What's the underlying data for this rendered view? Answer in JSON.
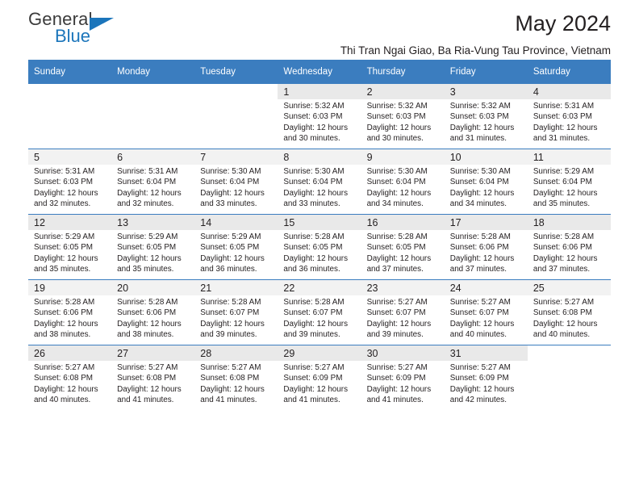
{
  "brand": {
    "name_top": "General",
    "name_bottom": "Blue",
    "accent_color": "#1b75bb"
  },
  "header": {
    "title": "May 2024",
    "location": "Thi Tran Ngai Giao, Ba Ria-Vung Tau Province, Vietnam"
  },
  "calendar": {
    "header_color": "#3b7dbf",
    "weekdays": [
      "Sunday",
      "Monday",
      "Tuesday",
      "Wednesday",
      "Thursday",
      "Friday",
      "Saturday"
    ],
    "weeks": [
      [
        {
          "day": "",
          "lines": []
        },
        {
          "day": "",
          "lines": []
        },
        {
          "day": "",
          "lines": []
        },
        {
          "day": "1",
          "lines": [
            "Sunrise: 5:32 AM",
            "Sunset: 6:03 PM",
            "Daylight: 12 hours",
            "and 30 minutes."
          ]
        },
        {
          "day": "2",
          "lines": [
            "Sunrise: 5:32 AM",
            "Sunset: 6:03 PM",
            "Daylight: 12 hours",
            "and 30 minutes."
          ]
        },
        {
          "day": "3",
          "lines": [
            "Sunrise: 5:32 AM",
            "Sunset: 6:03 PM",
            "Daylight: 12 hours",
            "and 31 minutes."
          ]
        },
        {
          "day": "4",
          "lines": [
            "Sunrise: 5:31 AM",
            "Sunset: 6:03 PM",
            "Daylight: 12 hours",
            "and 31 minutes."
          ]
        }
      ],
      [
        {
          "day": "5",
          "lines": [
            "Sunrise: 5:31 AM",
            "Sunset: 6:03 PM",
            "Daylight: 12 hours",
            "and 32 minutes."
          ]
        },
        {
          "day": "6",
          "lines": [
            "Sunrise: 5:31 AM",
            "Sunset: 6:04 PM",
            "Daylight: 12 hours",
            "and 32 minutes."
          ]
        },
        {
          "day": "7",
          "lines": [
            "Sunrise: 5:30 AM",
            "Sunset: 6:04 PM",
            "Daylight: 12 hours",
            "and 33 minutes."
          ]
        },
        {
          "day": "8",
          "lines": [
            "Sunrise: 5:30 AM",
            "Sunset: 6:04 PM",
            "Daylight: 12 hours",
            "and 33 minutes."
          ]
        },
        {
          "day": "9",
          "lines": [
            "Sunrise: 5:30 AM",
            "Sunset: 6:04 PM",
            "Daylight: 12 hours",
            "and 34 minutes."
          ]
        },
        {
          "day": "10",
          "lines": [
            "Sunrise: 5:30 AM",
            "Sunset: 6:04 PM",
            "Daylight: 12 hours",
            "and 34 minutes."
          ]
        },
        {
          "day": "11",
          "lines": [
            "Sunrise: 5:29 AM",
            "Sunset: 6:04 PM",
            "Daylight: 12 hours",
            "and 35 minutes."
          ]
        }
      ],
      [
        {
          "day": "12",
          "lines": [
            "Sunrise: 5:29 AM",
            "Sunset: 6:05 PM",
            "Daylight: 12 hours",
            "and 35 minutes."
          ]
        },
        {
          "day": "13",
          "lines": [
            "Sunrise: 5:29 AM",
            "Sunset: 6:05 PM",
            "Daylight: 12 hours",
            "and 35 minutes."
          ]
        },
        {
          "day": "14",
          "lines": [
            "Sunrise: 5:29 AM",
            "Sunset: 6:05 PM",
            "Daylight: 12 hours",
            "and 36 minutes."
          ]
        },
        {
          "day": "15",
          "lines": [
            "Sunrise: 5:28 AM",
            "Sunset: 6:05 PM",
            "Daylight: 12 hours",
            "and 36 minutes."
          ]
        },
        {
          "day": "16",
          "lines": [
            "Sunrise: 5:28 AM",
            "Sunset: 6:05 PM",
            "Daylight: 12 hours",
            "and 37 minutes."
          ]
        },
        {
          "day": "17",
          "lines": [
            "Sunrise: 5:28 AM",
            "Sunset: 6:06 PM",
            "Daylight: 12 hours",
            "and 37 minutes."
          ]
        },
        {
          "day": "18",
          "lines": [
            "Sunrise: 5:28 AM",
            "Sunset: 6:06 PM",
            "Daylight: 12 hours",
            "and 37 minutes."
          ]
        }
      ],
      [
        {
          "day": "19",
          "lines": [
            "Sunrise: 5:28 AM",
            "Sunset: 6:06 PM",
            "Daylight: 12 hours",
            "and 38 minutes."
          ]
        },
        {
          "day": "20",
          "lines": [
            "Sunrise: 5:28 AM",
            "Sunset: 6:06 PM",
            "Daylight: 12 hours",
            "and 38 minutes."
          ]
        },
        {
          "day": "21",
          "lines": [
            "Sunrise: 5:28 AM",
            "Sunset: 6:07 PM",
            "Daylight: 12 hours",
            "and 39 minutes."
          ]
        },
        {
          "day": "22",
          "lines": [
            "Sunrise: 5:28 AM",
            "Sunset: 6:07 PM",
            "Daylight: 12 hours",
            "and 39 minutes."
          ]
        },
        {
          "day": "23",
          "lines": [
            "Sunrise: 5:27 AM",
            "Sunset: 6:07 PM",
            "Daylight: 12 hours",
            "and 39 minutes."
          ]
        },
        {
          "day": "24",
          "lines": [
            "Sunrise: 5:27 AM",
            "Sunset: 6:07 PM",
            "Daylight: 12 hours",
            "and 40 minutes."
          ]
        },
        {
          "day": "25",
          "lines": [
            "Sunrise: 5:27 AM",
            "Sunset: 6:08 PM",
            "Daylight: 12 hours",
            "and 40 minutes."
          ]
        }
      ],
      [
        {
          "day": "26",
          "lines": [
            "Sunrise: 5:27 AM",
            "Sunset: 6:08 PM",
            "Daylight: 12 hours",
            "and 40 minutes."
          ]
        },
        {
          "day": "27",
          "lines": [
            "Sunrise: 5:27 AM",
            "Sunset: 6:08 PM",
            "Daylight: 12 hours",
            "and 41 minutes."
          ]
        },
        {
          "day": "28",
          "lines": [
            "Sunrise: 5:27 AM",
            "Sunset: 6:08 PM",
            "Daylight: 12 hours",
            "and 41 minutes."
          ]
        },
        {
          "day": "29",
          "lines": [
            "Sunrise: 5:27 AM",
            "Sunset: 6:09 PM",
            "Daylight: 12 hours",
            "and 41 minutes."
          ]
        },
        {
          "day": "30",
          "lines": [
            "Sunrise: 5:27 AM",
            "Sunset: 6:09 PM",
            "Daylight: 12 hours",
            "and 41 minutes."
          ]
        },
        {
          "day": "31",
          "lines": [
            "Sunrise: 5:27 AM",
            "Sunset: 6:09 PM",
            "Daylight: 12 hours",
            "and 42 minutes."
          ]
        },
        {
          "day": "",
          "lines": []
        }
      ]
    ]
  }
}
